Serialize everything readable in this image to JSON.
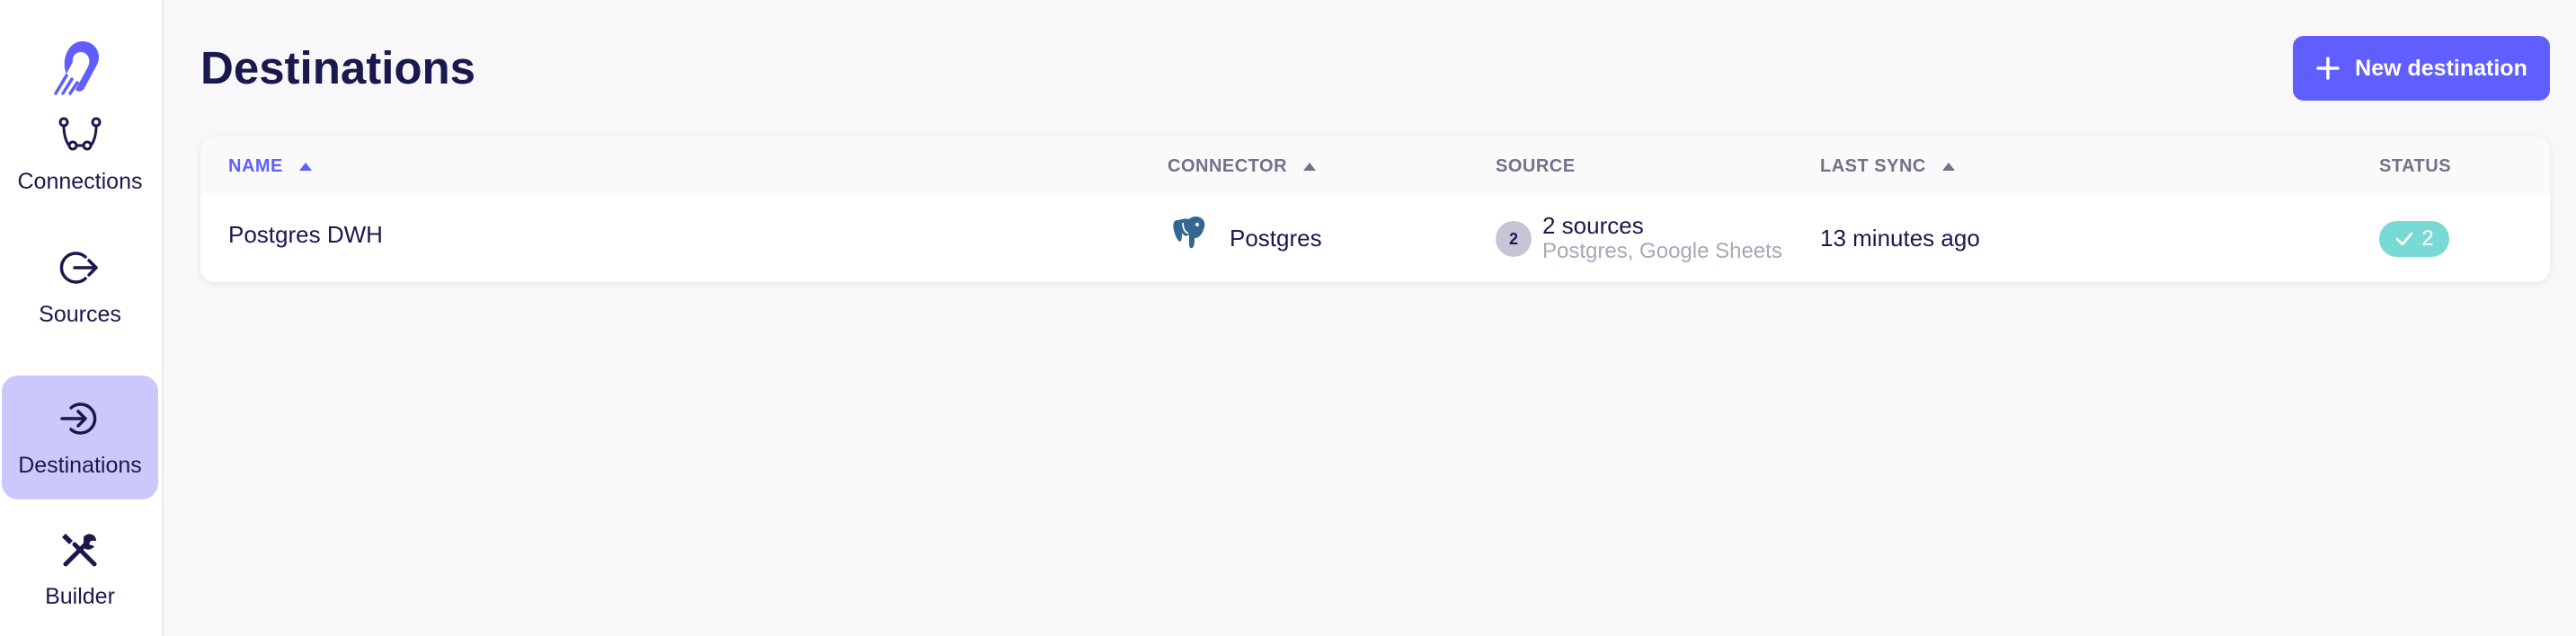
{
  "sidebar": {
    "logo_icon": "airbyte-logo",
    "items": [
      {
        "label": "Connections",
        "icon": "connections-icon",
        "active": false
      },
      {
        "label": "Sources",
        "icon": "sources-icon",
        "active": false
      },
      {
        "label": "Destinations",
        "icon": "destinations-icon",
        "active": true
      },
      {
        "label": "Builder",
        "icon": "builder-icon",
        "active": false
      }
    ]
  },
  "header": {
    "title": "Destinations",
    "new_button_label": "New destination",
    "new_button_icon": "plus-icon"
  },
  "table": {
    "columns": [
      {
        "label": "NAME",
        "sortable": true,
        "sorted": true
      },
      {
        "label": "CONNECTOR",
        "sortable": true,
        "sorted": false
      },
      {
        "label": "SOURCE",
        "sortable": false,
        "sorted": false
      },
      {
        "label": "LAST SYNC",
        "sortable": true,
        "sorted": false
      },
      {
        "label": "STATUS",
        "sortable": false,
        "sorted": false
      }
    ],
    "rows": [
      {
        "name": "Postgres DWH",
        "connector": "Postgres",
        "connector_icon": "postgres-elephant-icon",
        "source_count_badge": "2",
        "source_summary": "2 sources",
        "source_names": "Postgres, Google Sheets",
        "last_sync": "13 minutes ago",
        "status_count": "2",
        "status_icon": "check-icon"
      }
    ]
  },
  "colors": {
    "accent": "#615eff",
    "active_nav": "#cbc8fe",
    "status_ok": "#78d9d6",
    "text": "#1a194d",
    "muted": "#717189"
  }
}
